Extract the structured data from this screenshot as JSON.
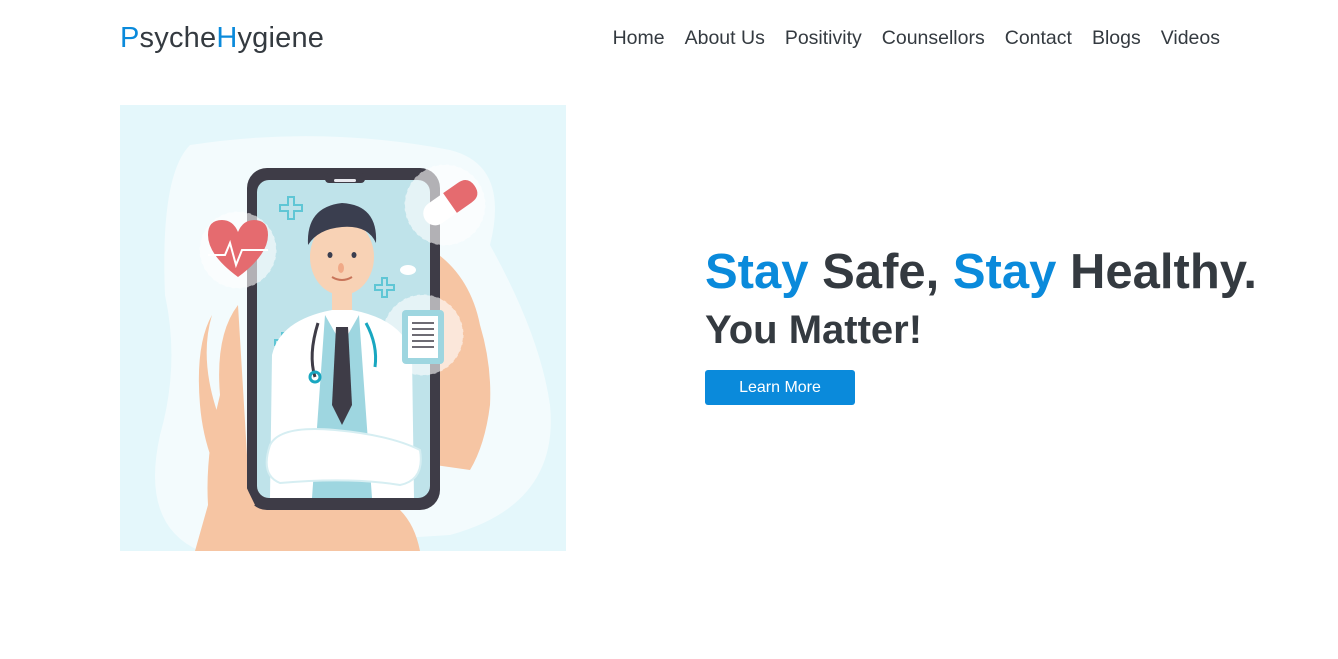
{
  "brand": {
    "part1_accent": "P",
    "part1_rest": "syche",
    "part2_accent": "H",
    "part2_rest": "ygiene"
  },
  "nav": {
    "items": [
      "Home",
      "About Us",
      "Positivity",
      "Counsellors",
      "Contact",
      "Blogs",
      "Videos"
    ]
  },
  "hero": {
    "headline": {
      "w1": "Stay",
      "w2": " Safe, ",
      "w3": "Stay",
      "w4": " Healthy."
    },
    "subline": "You Matter!",
    "button_label": "Learn More",
    "illustration": "doctor-on-phone-illustration"
  },
  "colors": {
    "accent": "#0a8adb",
    "text": "#343a40",
    "hero_bg": "#e4f7fb"
  }
}
